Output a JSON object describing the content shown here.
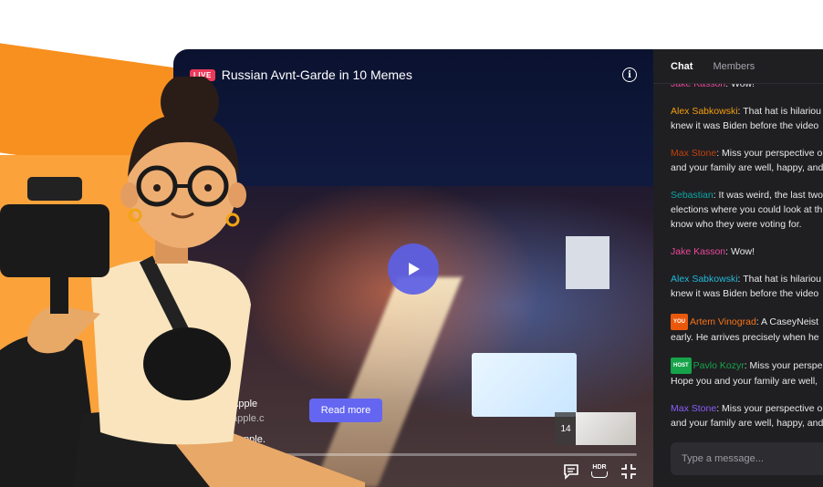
{
  "player": {
    "live_label": "LIVE",
    "title": "Russian Avnt-Garde in 10 Memes",
    "read_more_label": "Read more",
    "promo": {
      "line1": "Apple",
      "line2": "apple.c",
      "line3": "• apple."
    },
    "thumbnail_count": "14",
    "progress": 0.05,
    "icons": {
      "info": "info-icon",
      "play": "play-icon",
      "volume": "volume-icon",
      "chat": "chat-icon",
      "hdr": "hdr-icon",
      "fullscreen": "fullscreen-exit-icon"
    },
    "hdr_label": "HDR",
    "accent_color": "#6466f1",
    "live_color": "#ec3a5a"
  },
  "chat": {
    "tabs": [
      {
        "label": "Chat",
        "active": true
      },
      {
        "label": "Members",
        "active": false
      }
    ],
    "messages": [
      {
        "user": "Jake Kasson",
        "color": "#ec4899",
        "badge": "",
        "lines": [
          "Wow!"
        ]
      },
      {
        "user": "Alex Sabkowski",
        "color": "#f59e0b",
        "badge": "",
        "lines": [
          "That hat is hilariou",
          "knew it was Biden before the video"
        ]
      },
      {
        "user": "Max Stone",
        "color": "#c2410c",
        "badge": "",
        "lines": [
          "Miss your perspective o",
          "and your family are well, happy, and"
        ]
      },
      {
        "user": "Sebastian",
        "color": "#0ea5a5",
        "badge": "",
        "lines": [
          "It was weird, the last two",
          "elections where you could look at th",
          "know who they were voting for."
        ]
      },
      {
        "user": "Jake Kasson",
        "color": "#ec4899",
        "badge": "",
        "lines": [
          "Wow!"
        ]
      },
      {
        "user": "Alex Sabkowski",
        "color": "#22b8d8",
        "badge": "",
        "lines": [
          "That hat is hilariou",
          "knew it was Biden before the video"
        ]
      },
      {
        "user": "Artem Vinograd",
        "color": "#f97316",
        "badge": "YOU",
        "lines": [
          "A CaseyNeist",
          "early. He arrives precisely when he"
        ]
      },
      {
        "user": "Pavlo Kozyr",
        "color": "#16a34a",
        "badge": "HOST",
        "lines": [
          "Miss your perspe",
          "Hope you and your family are well,"
        ]
      },
      {
        "user": "Max Stone",
        "color": "#8b5cf6",
        "badge": "",
        "lines": [
          "Miss your perspective o",
          "and your family are well, happy, and"
        ]
      }
    ],
    "input_placeholder": "Type a message..."
  }
}
